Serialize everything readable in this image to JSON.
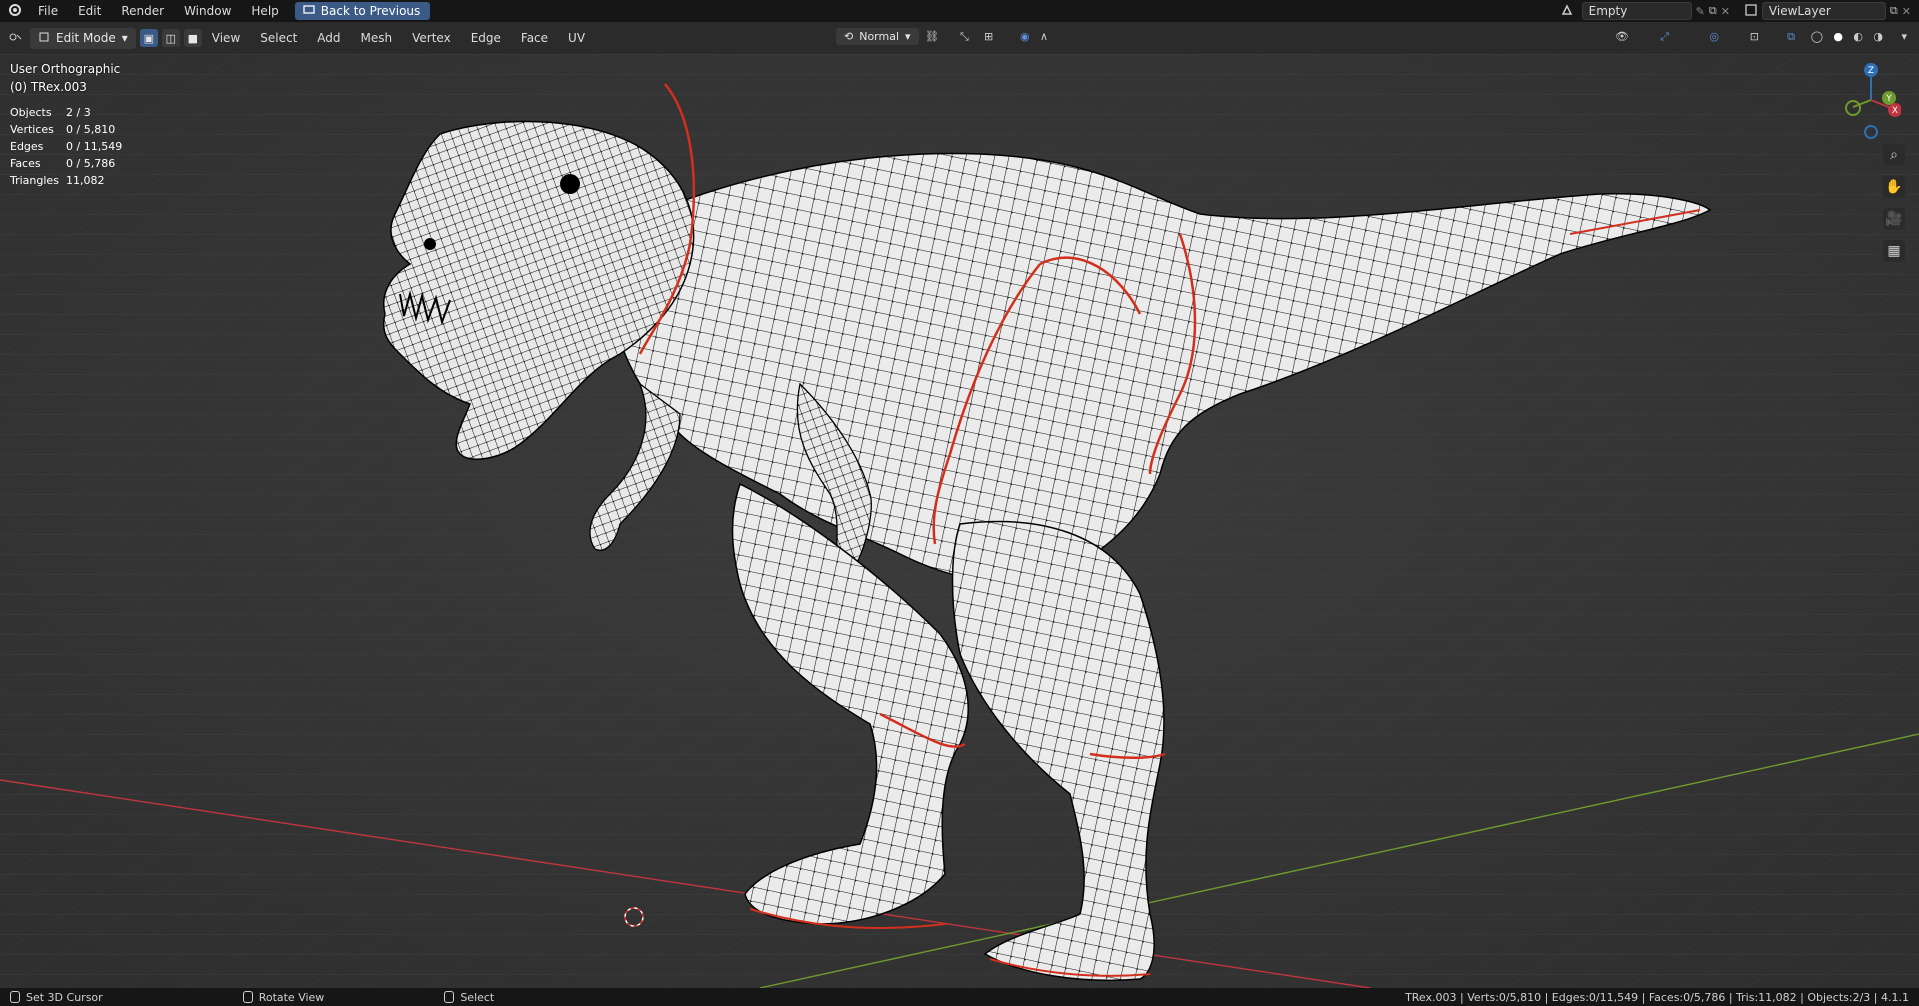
{
  "topbar": {
    "menu": [
      "File",
      "Edit",
      "Render",
      "Window",
      "Help"
    ],
    "back_button": "Back to Previous",
    "scene_field": "Empty",
    "view_layer": "ViewLayer"
  },
  "header": {
    "mode": "Edit Mode",
    "menus": [
      "View",
      "Select",
      "Add",
      "Mesh",
      "Vertex",
      "Edge",
      "Face",
      "UV"
    ],
    "transform_orientation": "Normal"
  },
  "viewport": {
    "view_name": "User Orthographic",
    "object_name": "(0) TRex.003",
    "stats": [
      {
        "label": "Objects",
        "value": "2 / 3"
      },
      {
        "label": "Vertices",
        "value": "0 / 5,810"
      },
      {
        "label": "Edges",
        "value": "0 / 11,549"
      },
      {
        "label": "Faces",
        "value": "0 / 5,786"
      },
      {
        "label": "Triangles",
        "value": "11,082"
      }
    ],
    "gizmo_axes": [
      "Z",
      "Y",
      "X"
    ]
  },
  "statusbar": {
    "hint1": "Set 3D Cursor",
    "hint2": "Rotate View",
    "hint3": "Select",
    "info": "TRex.003 | Verts:0/5,810 | Edges:0/11,549 | Faces:0/5,786 | Tris:11,082 | Objects:2/3 | 4.1.1"
  },
  "colors": {
    "accent": "#3b5a86",
    "axis_x": "#c0353f",
    "axis_y": "#6e9a2e",
    "axis_z": "#2d6fb5",
    "seam": "#d32f1d"
  }
}
